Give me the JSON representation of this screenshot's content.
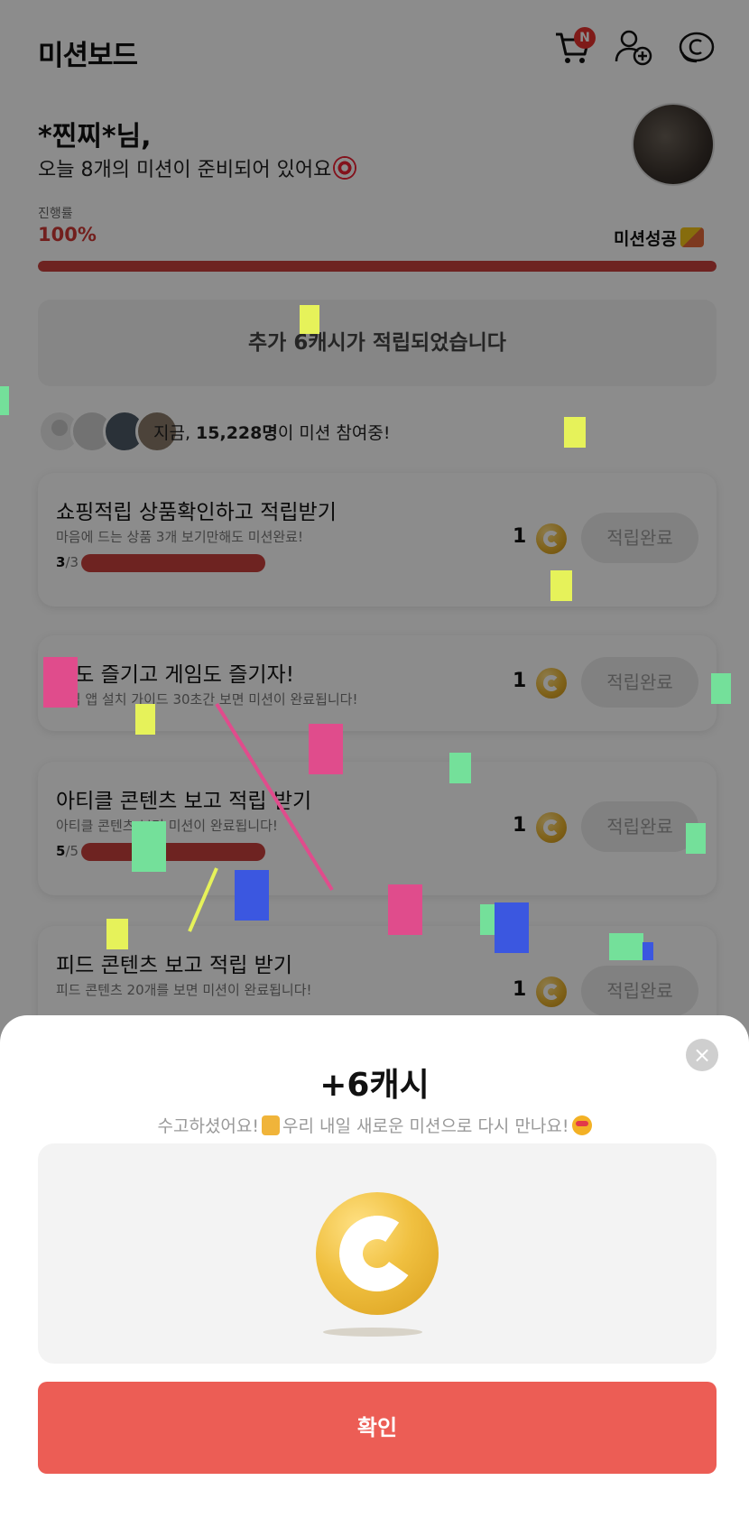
{
  "header": {
    "title": "미션보드",
    "cart_badge": "N",
    "icons": [
      "cart-icon",
      "add-user-icon",
      "coin-icon"
    ]
  },
  "greeting": {
    "name": "*찐찌*님,",
    "subtitle": "오늘 8개의 미션이 준비되어 있어요"
  },
  "progress": {
    "label": "진행률",
    "value_text": "100%",
    "value": 1.0,
    "status": "미션성공"
  },
  "notice": "추가 6캐시가 적립되었습니다",
  "participants": {
    "prefix": "지금, ",
    "count": "15,228명",
    "suffix": "이 미션 참여중!"
  },
  "missions": [
    {
      "title": "쇼핑적립 상품확인하고 적립받기",
      "desc": "마음에 드는 상품 3개 보기만해도 미션완료!",
      "done": "3",
      "total": "/3",
      "reward": "1",
      "button": "적립완료"
    },
    {
      "title": "핑도 즐기고 게임도 즐기자!",
      "desc": "적립 앱 설치 가이드 30초간 보면 미션이 완료됩니다!",
      "reward": "1",
      "button": "적립완료"
    },
    {
      "title": "아티클 콘텐츠 보고 적립 받기",
      "desc": "아티클 콘텐츠 보면 미션이 완료됩니다!",
      "done": "5",
      "total": "/5",
      "reward": "1",
      "button": "적립완료"
    },
    {
      "title": "피드 콘텐츠 보고 적립 받기",
      "desc": "피드 콘텐츠 20개를 보면 미션이 완료됩니다!",
      "reward": "1",
      "button": "적립완료"
    }
  ],
  "popup": {
    "amount": "+6캐시",
    "message_a": "수고하셨어요!",
    "message_b": "우리 내일 새로운 미션으로 다시 만나요!",
    "confirm": "확인",
    "close": "×"
  },
  "colors": {
    "accent": "#ec5d55",
    "progress": "#c8413c",
    "coin": "#f0c040"
  }
}
